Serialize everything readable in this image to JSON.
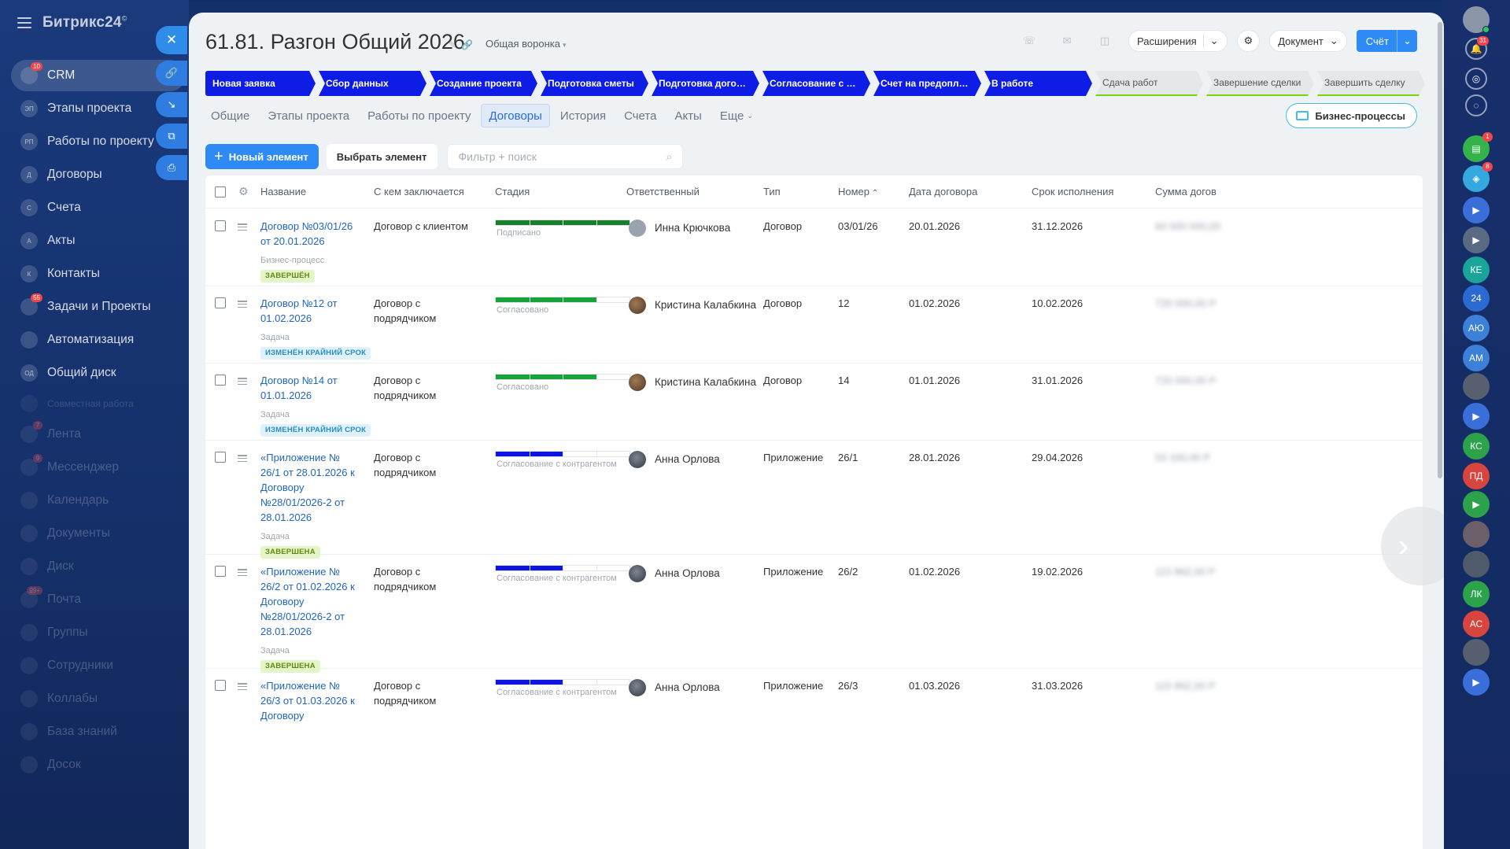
{
  "app": {
    "name": "Битрикс24"
  },
  "sidebar": {
    "items": [
      {
        "label": "CRM",
        "abbr": "",
        "badge": "10",
        "active": true,
        "dim": false
      },
      {
        "label": "Этапы проекта",
        "abbr": "ЭП",
        "badge": "",
        "active": false,
        "dim": false
      },
      {
        "label": "Работы по проекту",
        "abbr": "РП",
        "badge": "",
        "active": false,
        "dim": false
      },
      {
        "label": "Договоры",
        "abbr": "Д",
        "badge": "",
        "active": false,
        "dim": false
      },
      {
        "label": "Счета",
        "abbr": "С",
        "badge": "",
        "active": false,
        "dim": false
      },
      {
        "label": "Акты",
        "abbr": "А",
        "badge": "",
        "active": false,
        "dim": false
      },
      {
        "label": "Контакты",
        "abbr": "К",
        "badge": "",
        "active": false,
        "dim": false
      },
      {
        "label": "Задачи и Проекты",
        "abbr": "",
        "badge": "55",
        "active": false,
        "dim": false
      },
      {
        "label": "Автоматизация",
        "abbr": "",
        "badge": "",
        "active": false,
        "dim": false
      },
      {
        "label": "Общий диск",
        "abbr": "ОД",
        "badge": "",
        "active": false,
        "dim": false
      }
    ],
    "section_label": "Совместная работа",
    "dim_items": [
      {
        "label": "Лента",
        "badge": "7"
      },
      {
        "label": "Мессенджер",
        "badge": "9"
      },
      {
        "label": "Календарь",
        "badge": ""
      },
      {
        "label": "Документы",
        "badge": ""
      },
      {
        "label": "Диск",
        "badge": ""
      },
      {
        "label": "Почта",
        "badge": "99+"
      },
      {
        "label": "Группы",
        "badge": ""
      },
      {
        "label": "Сотрудники",
        "badge": ""
      },
      {
        "label": "Коллабы",
        "badge": ""
      },
      {
        "label": "База знаний",
        "badge": ""
      },
      {
        "label": "Досок",
        "badge": ""
      }
    ]
  },
  "header": {
    "title": "61.81. Разгон Общий 2026",
    "funnel": "Общая воронка",
    "extensions_label": "Расширения",
    "document_label": "Документ",
    "invoice_label": "Счёт",
    "bp_label": "Бизнес-процессы"
  },
  "stages": [
    {
      "label": "Новая заявка",
      "done": true
    },
    {
      "label": "Сбор данных",
      "done": true
    },
    {
      "label": "Создание проекта",
      "done": true
    },
    {
      "label": "Подготовка сметы",
      "done": true
    },
    {
      "label": "Подготовка договора",
      "done": true
    },
    {
      "label": "Согласование с заказчиком",
      "done": true
    },
    {
      "label": "Счет на предоплату",
      "done": true
    },
    {
      "label": "В работе",
      "done": true
    },
    {
      "label": "Сдача работ",
      "done": false
    },
    {
      "label": "Завершение сделки",
      "done": false
    },
    {
      "label": "Завершить сделку",
      "done": false
    }
  ],
  "tabs": [
    {
      "label": "Общие",
      "active": false
    },
    {
      "label": "Этапы проекта",
      "active": false
    },
    {
      "label": "Работы по проекту",
      "active": false
    },
    {
      "label": "Договоры",
      "active": true
    },
    {
      "label": "История",
      "active": false
    },
    {
      "label": "Счета",
      "active": false
    },
    {
      "label": "Акты",
      "active": false
    },
    {
      "label": "Еще",
      "active": false
    }
  ],
  "toolbar": {
    "new_label": "Новый элемент",
    "select_label": "Выбрать элемент",
    "search_placeholder": "Фильтр + поиск"
  },
  "grid": {
    "columns": [
      "Название",
      "С кем заключается",
      "Стадия",
      "Ответственный",
      "Тип",
      "Номер",
      "Дата договора",
      "Срок исполнения",
      "Сумма догов"
    ],
    "rows": [
      {
        "name": "Договор №03/01/26 от 20.01.2026",
        "party": "Договор с клиентом",
        "stage": "Подписано",
        "progress": 1.0,
        "color": "#1a7f2d",
        "responsible": "Инна Крючкова",
        "type": "Договор",
        "number": "03/01/26",
        "date": "20.01.2026",
        "due": "31.12.2026",
        "sum": "60 000 000,00",
        "sub_label": "Бизнес-процесс",
        "tag": "ЗАВЕРШЁН",
        "tag_color": "green"
      },
      {
        "name": "Договор №12 от 01.02.2026",
        "party": "Договор с подрядчиком",
        "stage": "Согласовано",
        "progress": 0.75,
        "color": "#18a23b",
        "responsible": "Кристина Калабкина",
        "type": "Договор",
        "number": "12",
        "date": "01.02.2026",
        "due": "10.02.2026",
        "sum": "720 000,00 Р",
        "sub_label": "Задача",
        "tag": "ИЗМЕНЁН КРАЙНИЙ СРОК",
        "tag_color": "blue"
      },
      {
        "name": "Договор №14 от 01.01.2026",
        "party": "Договор с подрядчиком",
        "stage": "Согласовано",
        "progress": 0.75,
        "color": "#18a23b",
        "responsible": "Кристина Калабкина",
        "type": "Договор",
        "number": "14",
        "date": "01.01.2026",
        "due": "31.01.2026",
        "sum": "720 000,00 Р",
        "sub_label": "Задача",
        "tag": "ИЗМЕНЁН КРАЙНИЙ СРОК",
        "tag_color": "blue"
      },
      {
        "name": "«Приложение № 26/1 от 28.01.2026 к Договору №28/01/2026-2 от 28.01.2026",
        "party": "Договор с подрядчиком",
        "stage": "Согласование с контрагентом",
        "progress": 0.5,
        "color": "#0b14e0",
        "responsible": "Анна Орлова",
        "type": "Приложение",
        "number": "26/1",
        "date": "28.01.2026",
        "due": "29.04.2026",
        "sum": "53 100,00 Р",
        "sub_label": "Задача",
        "tag": "ЗАВЕРШЕНА",
        "tag_color": "green"
      },
      {
        "name": "«Приложение № 26/2 от 01.02.2026 к Договору №28/01/2026-2 от 28.01.2026",
        "party": "Договор с подрядчиком",
        "stage": "Согласование с контрагентом",
        "progress": 0.5,
        "color": "#0b14e0",
        "responsible": "Анна Орлова",
        "type": "Приложение",
        "number": "26/2",
        "date": "01.02.2026",
        "due": "19.02.2026",
        "sum": "115 862,00 Р",
        "sub_label": "Задача",
        "tag": "ЗАВЕРШЕНА",
        "tag_color": "green"
      },
      {
        "name": "«Приложение № 26/3 от 01.03.2026 к Договору",
        "party": "Договор с подрядчиком",
        "stage": "Согласование с контрагентом",
        "progress": 0.5,
        "color": "#0b14e0",
        "responsible": "Анна Орлова",
        "type": "Приложение",
        "number": "26/3",
        "date": "01.03.2026",
        "due": "31.03.2026",
        "sum": "115 862,00 Р",
        "sub_label": "",
        "tag": "",
        "tag_color": ""
      }
    ]
  },
  "right_bar": [
    {
      "name": "user-avatar",
      "label": "",
      "color": "#8a96a8",
      "badge": ""
    },
    {
      "name": "notifications-icon",
      "label": "🔔",
      "color": "transparent",
      "badge": "31"
    },
    {
      "name": "copilot-icon",
      "label": "◎",
      "color": "transparent",
      "badge": ""
    },
    {
      "name": "chat-search-icon",
      "label": "◌",
      "color": "transparent",
      "badge": ""
    },
    {
      "name": "tasks-chat",
      "label": "▤",
      "color": "#33b34a",
      "badge": "1"
    },
    {
      "name": "support-chat",
      "label": "◈",
      "color": "#35a8e0",
      "badge": "8"
    },
    {
      "name": "video-chat",
      "label": "▶",
      "color": "#3a6ed8",
      "badge": ""
    },
    {
      "name": "video-chat-2",
      "label": "▶",
      "color": "#5a6a82",
      "badge": ""
    },
    {
      "name": "contact-ke",
      "label": "КЕ",
      "color": "#19a59a",
      "badge": ""
    },
    {
      "name": "b24-chat",
      "label": "24",
      "color": "#2b6ad0",
      "badge": ""
    },
    {
      "name": "contact-aio",
      "label": "АЮ",
      "color": "#3c80d8",
      "badge": ""
    },
    {
      "name": "contact-am",
      "label": "АМ",
      "color": "#3c80d8",
      "badge": ""
    },
    {
      "name": "contact-photo-1",
      "label": "",
      "color": "#56606e",
      "badge": ""
    },
    {
      "name": "video-chat-3",
      "label": "▶",
      "color": "#3a6ed8",
      "badge": ""
    },
    {
      "name": "contact-ks",
      "label": "КС",
      "color": "#2ca34a",
      "badge": ""
    },
    {
      "name": "contact-pd",
      "label": "ПД",
      "color": "#d8453e",
      "badge": ""
    },
    {
      "name": "video-chat-4",
      "label": "▶",
      "color": "#2ca34a",
      "badge": ""
    },
    {
      "name": "contact-photo-2",
      "label": "",
      "color": "#6d5f6a",
      "badge": ""
    },
    {
      "name": "contact-photo-3",
      "label": "",
      "color": "#4f5a6a",
      "badge": ""
    },
    {
      "name": "contact-lk",
      "label": "ЛК",
      "color": "#2ca34a",
      "badge": ""
    },
    {
      "name": "contact-as",
      "label": "АС",
      "color": "#d8453e",
      "badge": ""
    },
    {
      "name": "contact-photo-4",
      "label": "",
      "color": "#555f6e",
      "badge": ""
    },
    {
      "name": "video-chat-5",
      "label": "▶",
      "color": "#3a6ed8",
      "badge": ""
    }
  ]
}
